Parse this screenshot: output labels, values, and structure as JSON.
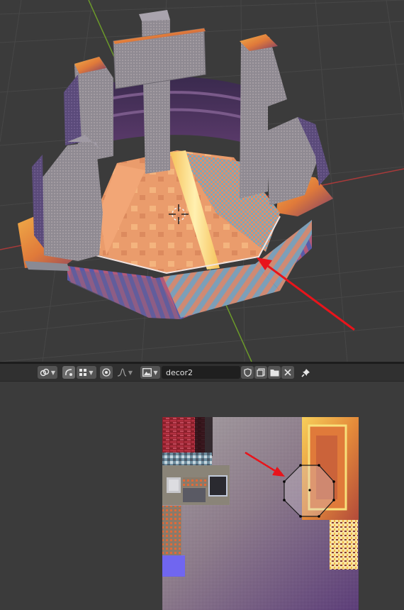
{
  "toolbar": {
    "image_name": "decor2",
    "icons": [
      "link-icon",
      "sticky-select-icon",
      "snap-grid-icon",
      "proportional-edit-icon",
      "falloff-curve-icon",
      "image-browse-icon",
      "fake-user-shield-icon",
      "new-image-icon",
      "open-folder-icon",
      "unlink-close-icon",
      "pin-icon"
    ]
  },
  "colors": {
    "viewport_bg": "#3b3b3b",
    "grid_line": "#474747",
    "x_axis": "#a83a3a",
    "y_axis": "#6c9a2a",
    "annotation_arrow": "#e8141b",
    "header_bg": "#303030",
    "field_bg": "#1f1f1f",
    "button_bg": "#545454"
  }
}
